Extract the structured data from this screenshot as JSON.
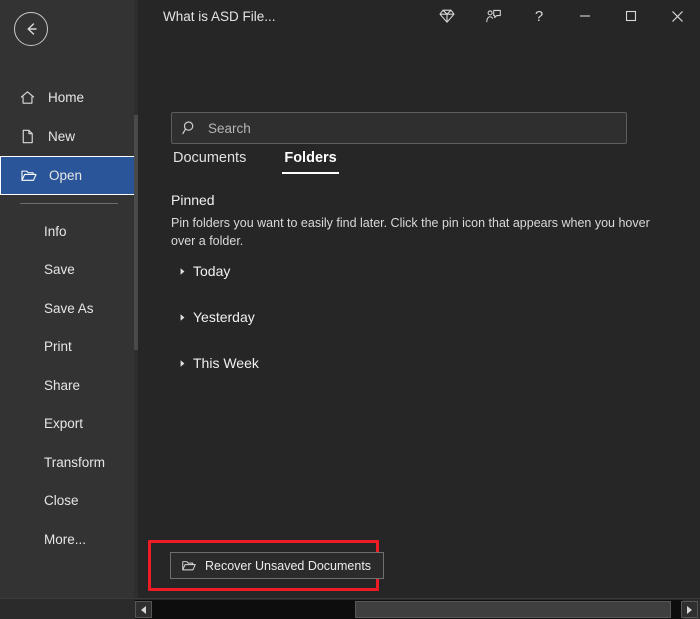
{
  "window": {
    "title": "What is ASD File...",
    "background_color": "#262626",
    "sidebar_color": "#333333",
    "accent_color": "#2a5699",
    "highlight_color": "#ee1c25"
  },
  "titlebar": {
    "back_icon": "back-arrow-icon",
    "controls": [
      {
        "name": "diamond-icon",
        "label": "Microsoft 365"
      },
      {
        "name": "feedback-icon",
        "label": "Feedback"
      },
      {
        "name": "help-icon",
        "label": "?"
      },
      {
        "name": "minimize-icon",
        "label": "Minimize"
      },
      {
        "name": "maximize-icon",
        "label": "Maximize"
      },
      {
        "name": "close-icon",
        "label": "Close"
      }
    ]
  },
  "sidebar": {
    "top_items": [
      {
        "label": "Home",
        "icon": "home-icon",
        "selected": false
      },
      {
        "label": "New",
        "icon": "new-document-icon",
        "selected": false
      },
      {
        "label": "Open",
        "icon": "open-folder-icon",
        "selected": true
      }
    ],
    "bottom_items": [
      {
        "label": "Info"
      },
      {
        "label": "Save"
      },
      {
        "label": "Save As"
      },
      {
        "label": "Print"
      },
      {
        "label": "Share"
      },
      {
        "label": "Export"
      },
      {
        "label": "Transform"
      },
      {
        "label": "Close"
      },
      {
        "label": "More..."
      }
    ]
  },
  "main": {
    "search": {
      "placeholder": "Search",
      "value": "",
      "icon": "search-icon"
    },
    "tabs": [
      {
        "label": "Documents",
        "active": false
      },
      {
        "label": "Folders",
        "active": true
      }
    ],
    "pinned": {
      "heading": "Pinned",
      "description": "Pin folders you want to easily find later. Click the pin icon that appears when you hover over a folder."
    },
    "groups": [
      {
        "label": "Today",
        "expanded": false
      },
      {
        "label": "Yesterday",
        "expanded": false
      },
      {
        "label": "This Week",
        "expanded": false
      }
    ],
    "recover_button": {
      "label": "Recover Unsaved Documents",
      "icon": "open-folder-icon",
      "highlighted": true
    }
  },
  "scrollbar": {
    "left_arrow": "arrow-left-icon",
    "right_arrow": "arrow-right-icon"
  }
}
